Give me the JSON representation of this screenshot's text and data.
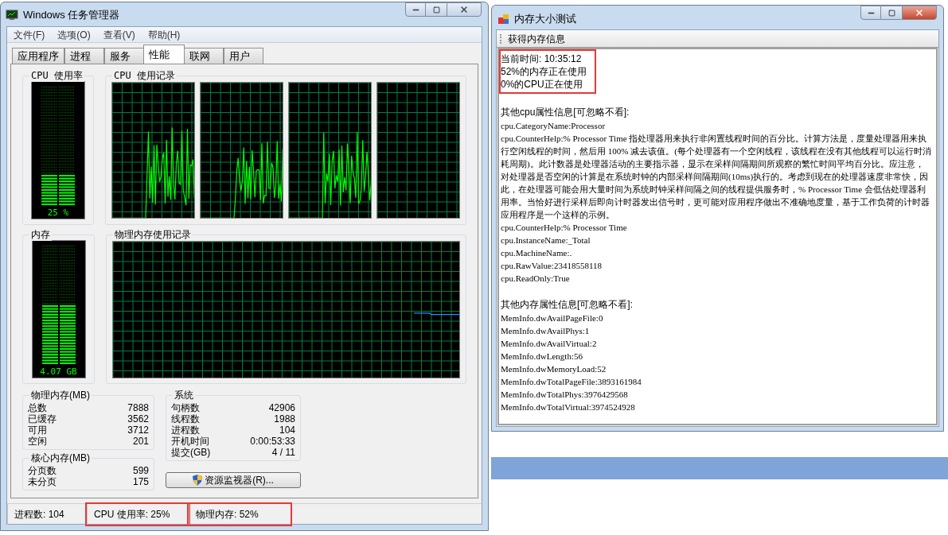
{
  "task_manager": {
    "title": "Windows 任务管理器",
    "menu": [
      "文件(F)",
      "选项(O)",
      "查看(V)",
      "帮助(H)"
    ],
    "tabs": [
      {
        "label": "应用程序",
        "selected": false
      },
      {
        "label": "进程",
        "selected": false
      },
      {
        "label": "服务",
        "selected": false
      },
      {
        "label": "性能",
        "selected": true
      },
      {
        "label": "联网",
        "selected": false
      },
      {
        "label": "用户",
        "selected": false
      }
    ],
    "cpu_usage": {
      "title": "CPU 使用率",
      "level": 0.25,
      "reading": "25 %"
    },
    "cpu_history": {
      "title": "CPU 使用记录"
    },
    "memory": {
      "title": "内存",
      "level": 0.5,
      "reading": "4.07 GB"
    },
    "memory_history": {
      "title": "物理内存使用记录"
    },
    "physical_memory": {
      "title": "物理内存(MB)",
      "rows": [
        {
          "label": "总数",
          "value": "7888"
        },
        {
          "label": "已缓存",
          "value": "3562"
        },
        {
          "label": "可用",
          "value": "3712"
        },
        {
          "label": "空闲",
          "value": "201"
        }
      ]
    },
    "kernel_memory": {
      "title": "核心内存(MB)",
      "rows": [
        {
          "label": "分页数",
          "value": "599"
        },
        {
          "label": "未分页",
          "value": "175"
        }
      ]
    },
    "system": {
      "title": "系统",
      "rows": [
        {
          "label": "句柄数",
          "value": "42906"
        },
        {
          "label": "线程数",
          "value": "1988"
        },
        {
          "label": "进程数",
          "value": "104"
        },
        {
          "label": "开机时间",
          "value": "0:00:53:33"
        },
        {
          "label": "提交(GB)",
          "value": "4 / 11"
        }
      ]
    },
    "resource_monitor_button": "资源监视器(R)...",
    "status_bar": [
      {
        "text": "进程数: 104",
        "highlighted": false
      },
      {
        "text": "CPU 使用率: 25%",
        "highlighted": true
      },
      {
        "text": "物理内存: 52%",
        "highlighted": true
      }
    ]
  },
  "memory_test": {
    "title": "内存大小测试",
    "toolbar_button": "获得内存信息",
    "status_lines": [
      "当前时间: 10:35:12",
      "52%的内存正在使用",
      "0%的CPU正在使用"
    ],
    "status_highlighted": true,
    "sections": [
      {
        "heading": "其他cpu属性信息[可忽略不看]:",
        "lines": [
          "cpu.CategoryName:Processor",
          "cpu.CounterHelp:% Processor Time 指处理器用来执行非闲置线程时间的百分比。计算方法是，度量处理器用来执行空闲线程的时间，然后用 100% 减去该值。(每个处理器有一个空闲线程，该线程在没有其他线程可以运行时消耗周期)。此计数器是处理器活动的主要指示器，显示在采样间隔期间所观察的繁忙时间平均百分比。应注意，对处理器是否空闲的计算是在系统时钟的内部采样间隔期间(10ms)执行的。考虑到现在的处理器速度非常快，因此，在处理器可能会用大量时间为系统时钟采样间隔之间的线程提供服务时，% Processor Time 会低估处理器利用率。当恰好进行采样后即向计时器发出信号时，更可能对应用程序做出不准确地度量，基于工作负荷的计时器应用程序是一个这样的示例。",
          "cpu.CounterHelp:% Processor Time",
          "cpu.InstanceName:_Total",
          "cpu.MachineName:.",
          "cpu.RawValue:23418558118",
          "cpu.ReadOnly:True"
        ]
      },
      {
        "heading": "其他内存属性信息[可忽略不看]:",
        "lines": [
          "MemInfo.dwAvailPageFile:0",
          "MemInfo.dwAvailPhys:1",
          "MemInfo.dwAvailVirtual:2",
          "MemInfo.dwLength:56",
          "MemInfo.dwMemoryLoad:52",
          "MemInfo.dwTotalPageFile:3893161984",
          "MemInfo.dwTotalPhys:3976429568",
          "MemInfo.dwTotalVirtual:3974524928"
        ]
      }
    ]
  }
}
